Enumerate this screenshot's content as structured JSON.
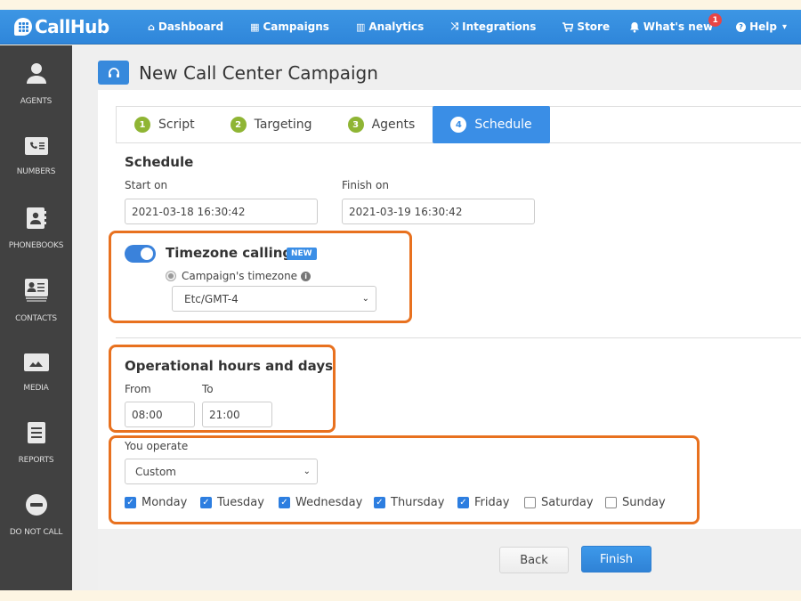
{
  "app": {
    "brand": "CallHub"
  },
  "topnav": {
    "items": [
      {
        "label": "Dashboard",
        "icon": "home-icon",
        "glyph": "⌂"
      },
      {
        "label": "Campaigns",
        "icon": "table-icon",
        "glyph": "▦"
      },
      {
        "label": "Analytics",
        "icon": "chart-icon",
        "glyph": "▥"
      },
      {
        "label": "Integrations",
        "icon": "shuffle-icon",
        "glyph": "⤨"
      },
      {
        "label": "Store",
        "icon": "cart-icon",
        "glyph": "🛒"
      }
    ],
    "whats_new": {
      "label": "What's new",
      "badge": "1"
    },
    "help": {
      "label": "Help",
      "chevron": "▾"
    }
  },
  "sidebar": {
    "items": [
      {
        "label": "AGENTS"
      },
      {
        "label": "NUMBERS"
      },
      {
        "label": "PHONEBOOKS"
      },
      {
        "label": "CONTACTS"
      },
      {
        "label": "MEDIA"
      },
      {
        "label": "REPORTS"
      },
      {
        "label": "DO NOT CALL"
      }
    ]
  },
  "page": {
    "title": "New Call Center Campaign"
  },
  "steps": [
    {
      "num": "1",
      "label": "Script"
    },
    {
      "num": "2",
      "label": "Targeting"
    },
    {
      "num": "3",
      "label": "Agents"
    },
    {
      "num": "4",
      "label": "Schedule",
      "active": true
    }
  ],
  "schedule": {
    "heading": "Schedule",
    "start_label": "Start on",
    "start_value": "2021-03-18 16:30:42",
    "finish_label": "Finish on",
    "finish_value": "2021-03-19 16:30:42"
  },
  "timezone": {
    "label": "Timezone calling",
    "enabled": true,
    "new_badge": "NEW",
    "radio_label": "Campaign's timezone",
    "info_glyph": "i",
    "selected": "Etc/GMT-4"
  },
  "operational": {
    "heading": "Operational hours and days",
    "from_label": "From",
    "from_value": "08:00",
    "to_label": "To",
    "to_value": "21:00"
  },
  "operate": {
    "label": "You operate",
    "selected": "Custom",
    "days": [
      {
        "label": "Monday",
        "checked": true
      },
      {
        "label": "Tuesday",
        "checked": true
      },
      {
        "label": "Wednesday",
        "checked": true
      },
      {
        "label": "Thursday",
        "checked": true
      },
      {
        "label": "Friday",
        "checked": true
      },
      {
        "label": "Saturday",
        "checked": false
      },
      {
        "label": "Sunday",
        "checked": false
      }
    ]
  },
  "actions": {
    "back": "Back",
    "finish": "Finish"
  },
  "colors": {
    "brand_blue": "#2f86da",
    "highlight_orange": "#e8711f",
    "step_green": "#8fb534"
  }
}
